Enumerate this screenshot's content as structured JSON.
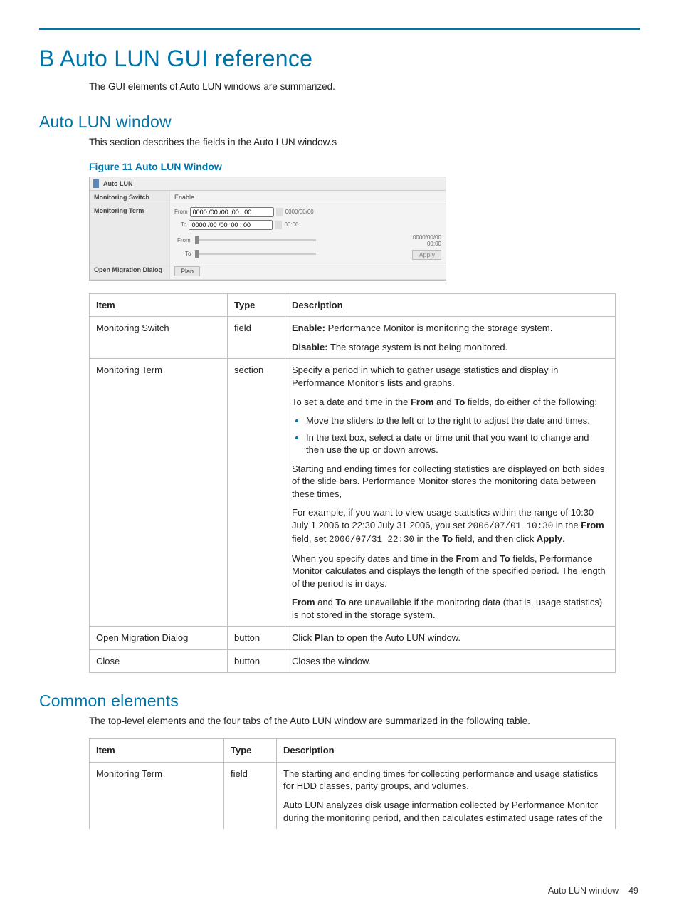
{
  "page_title": "B Auto LUN GUI reference",
  "intro": "The GUI elements of Auto LUN windows are summarized.",
  "section1_title": "Auto LUN window",
  "section1_intro": "This section describes the fields in the Auto LUN window.s",
  "fig_caption": "Figure 11 Auto LUN Window",
  "mock": {
    "window_title": "Auto LUN",
    "row_switch_label": "Monitoring Switch",
    "row_switch_value": "Enable",
    "row_term_label": "Monitoring Term",
    "term_from_label": "From",
    "term_to_label": "To",
    "term_datetime_placeholder": "0000 /00 /00  00 : 00",
    "slider_from_label": "From",
    "slider_to_label": "To",
    "slider_legend_top": "0000/00/00",
    "slider_legend_bot": "00:00",
    "right_date": "0000/00/00",
    "right_time": "00:00",
    "apply_btn": "Apply",
    "row_open_label": "Open Migration Dialog",
    "plan_btn": "Plan"
  },
  "table1_headers": {
    "c1": "Item",
    "c2": "Type",
    "c3": "Description"
  },
  "table1": {
    "r1": {
      "item": "Monitoring Switch",
      "type": "field",
      "enable_b": "Enable:",
      "enable_t": " Performance Monitor is monitoring the storage system.",
      "disable_b": "Disable:",
      "disable_t": " The storage system is not being monitored."
    },
    "r2": {
      "item": "Monitoring Term",
      "type": "section",
      "p1": "Specify a period in which to gather usage statistics and display in Performance Monitor's lists and graphs.",
      "p2a": "To set a date and time in the ",
      "p2b": "From",
      "p2c": " and ",
      "p2d": "To",
      "p2e": " fields, do either of the following:",
      "li1": "Move the sliders to the left or to the right to adjust the date and times.",
      "li2": "In the text box, select a date or time unit that you want to change and then use the up or down arrows.",
      "p3": "Starting and ending times for collecting statistics are displayed on both sides of the slide bars. Performance Monitor stores the monitoring data between these times,",
      "p4a": "For example, if you want to view usage statistics within the range of 10:30 July 1 2006 to 22:30 July 31 2006, you set ",
      "p4code1": "2006/07/01 10:30",
      "p4b": " in the ",
      "p4from": "From",
      "p4c": " field, set ",
      "p4code2": "2006/07/31 22:30",
      "p4d": " in the ",
      "p4to": "To",
      "p4e": " field, and then click ",
      "p4apply": "Apply",
      "p4f": ".",
      "p5a": "When you specify dates and time in the ",
      "p5from": "From",
      "p5b": " and ",
      "p5to": "To",
      "p5c": " fields, Performance Monitor calculates and displays the length of the specified period. The length of the period is in days.",
      "p6from": "From",
      "p6a": " and ",
      "p6to": "To",
      "p6b": " are unavailable if the monitoring data (that is, usage statistics) is not stored in the storage system."
    },
    "r3": {
      "item": "Open Migration Dialog",
      "type": "button",
      "a": "Click ",
      "b": "Plan",
      "c": " to open the Auto LUN window."
    },
    "r4": {
      "item": "Close",
      "type": "button",
      "desc": "Closes the window."
    }
  },
  "section2_title": "Common elements",
  "section2_intro": "The top-level elements and the four tabs of the Auto LUN window are summarized in the following table.",
  "table2_headers": {
    "c1": "Item",
    "c2": "Type",
    "c3": "Description"
  },
  "table2": {
    "r1": {
      "item": "Monitoring Term",
      "type": "field",
      "p1": "The starting and ending times for collecting performance and usage statistics for HDD classes, parity groups, and volumes.",
      "p2": "Auto LUN analyzes disk usage information collected by Performance Monitor during the monitoring period, and then calculates estimated usage rates of the"
    }
  },
  "footer_label": "Auto LUN window",
  "footer_page": "49"
}
